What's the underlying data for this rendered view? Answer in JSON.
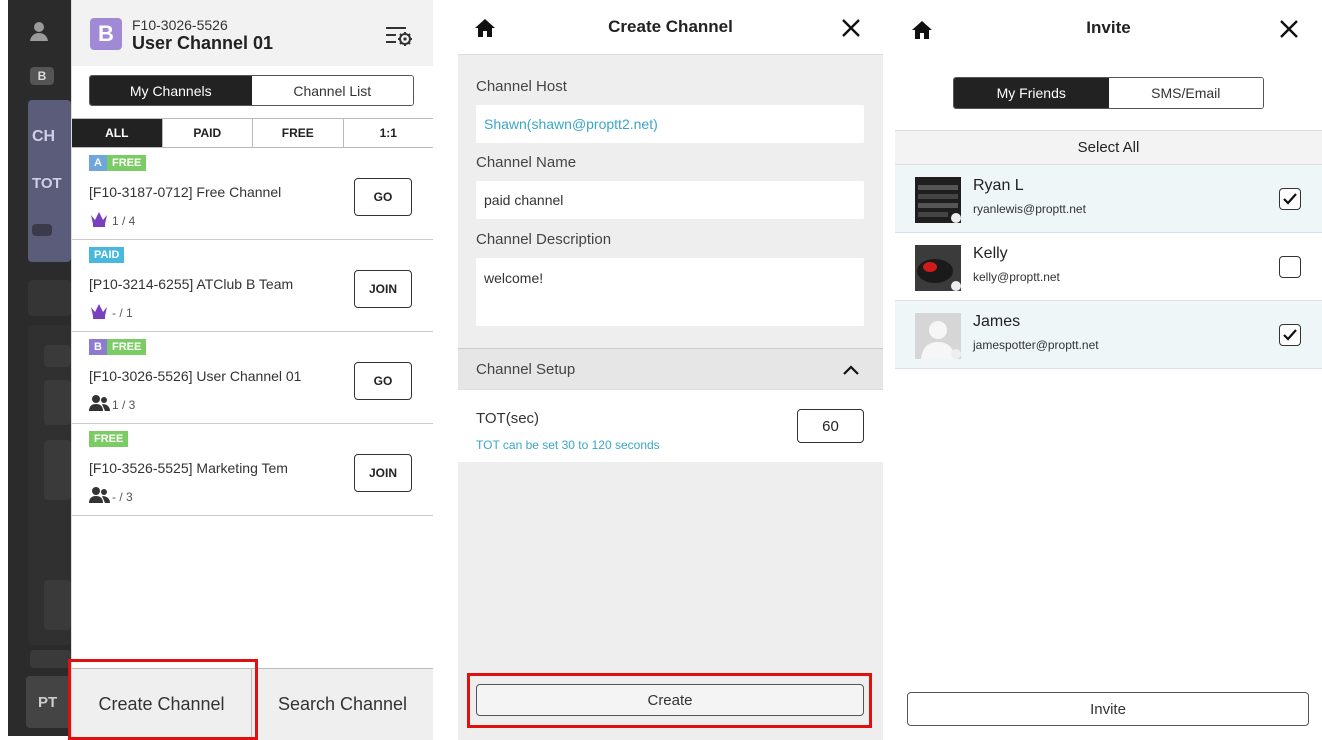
{
  "panel1": {
    "header": {
      "logo_letter": "B",
      "channel_id": "F10-3026-5526",
      "channel_name": "User Channel 01"
    },
    "segment": [
      "My Channels",
      "Channel List"
    ],
    "filters": [
      "ALL",
      "PAID",
      "FREE",
      "1:1"
    ],
    "channels": [
      {
        "tags": [
          "A",
          "FREE"
        ],
        "title": "[F10-3187-0712]  Free Channel",
        "count": "1 / 4",
        "action": "GO"
      },
      {
        "tags": [
          "PAID"
        ],
        "title": "[P10-3214-6255]  ATClub B Team",
        "count": "- / 1",
        "action": "JOIN"
      },
      {
        "tags": [
          "B",
          "FREE"
        ],
        "title": "[F10-3026-5526]  User Channel 01",
        "count": "1 / 3",
        "action": "GO"
      },
      {
        "tags": [
          "FREE"
        ],
        "title": "[F10-3526-5525]  Marketing Tem",
        "count": "- / 3",
        "action": "JOIN"
      }
    ],
    "footer": {
      "create": "Create Channel",
      "search": "Search Channel"
    },
    "side_labels": {
      "b": "B",
      "ch": "CH",
      "tot": "TOT",
      "pt": "PT"
    }
  },
  "panel2": {
    "title": "Create Channel",
    "host_label": "Channel Host",
    "host_value": "Shawn(shawn@proptt2.net)",
    "name_label": "Channel Name",
    "name_value": "paid channel",
    "desc_label": "Channel Description",
    "desc_value": "welcome!",
    "setup_label": "Channel Setup",
    "tot_label": "TOT(sec)",
    "tot_hint": "TOT can be set 30 to 120 seconds",
    "tot_value": "60",
    "create_label": "Create"
  },
  "panel3": {
    "title": "Invite",
    "segment": [
      "My Friends",
      "SMS/Email"
    ],
    "select_all": "Select All",
    "friends": [
      {
        "name": "Ryan L",
        "email": "ryanlewis@proptt.net",
        "checked": true
      },
      {
        "name": "Kelly",
        "email": "kelly@proptt.net",
        "checked": false
      },
      {
        "name": "James",
        "email": "jamespotter@proptt.net",
        "checked": true
      }
    ],
    "invite_label": "Invite"
  },
  "colors": {
    "accent_link": "#3aa6c9",
    "highlight": "#e01010",
    "tag_free": "#7ccc66",
    "tag_paid": "#48b8dc"
  }
}
